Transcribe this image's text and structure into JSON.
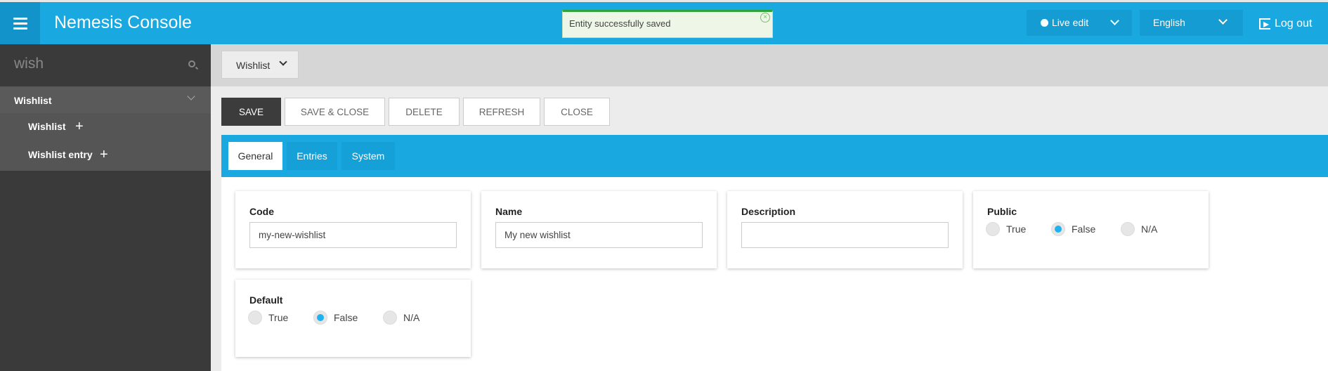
{
  "header": {
    "menu_icon": "hamburger-icon",
    "title": "Nemesis Console",
    "toast": "Entity successfully saved",
    "live_edit": "Live edit",
    "language": "English",
    "logout": "Log out"
  },
  "sidebar": {
    "search_value": "wish",
    "group": "Wishlist",
    "items": [
      {
        "label": "Wishlist"
      },
      {
        "label": "Wishlist entry"
      }
    ]
  },
  "main": {
    "entity_selector": "Wishlist",
    "toolbar": {
      "save": "SAVE",
      "save_close": "SAVE & CLOSE",
      "delete": "DELETE",
      "refresh": "REFRESH",
      "close": "CLOSE"
    },
    "tabs": [
      "General",
      "Entries",
      "System"
    ],
    "fields": {
      "code": {
        "label": "Code",
        "value": "my-new-wishlist"
      },
      "name": {
        "label": "Name",
        "value": "My new wishlist"
      },
      "description": {
        "label": "Description",
        "value": ""
      },
      "public": {
        "label": "Public",
        "options": [
          "True",
          "False",
          "N/A"
        ],
        "selected": "False"
      },
      "default": {
        "label": "Default",
        "options": [
          "True",
          "False",
          "N/A"
        ],
        "selected": "False"
      }
    }
  },
  "colors": {
    "accent": "#1aa8e0",
    "toolbar_primary": "#3c3c3c",
    "sidebar": "#3a3a3a"
  }
}
